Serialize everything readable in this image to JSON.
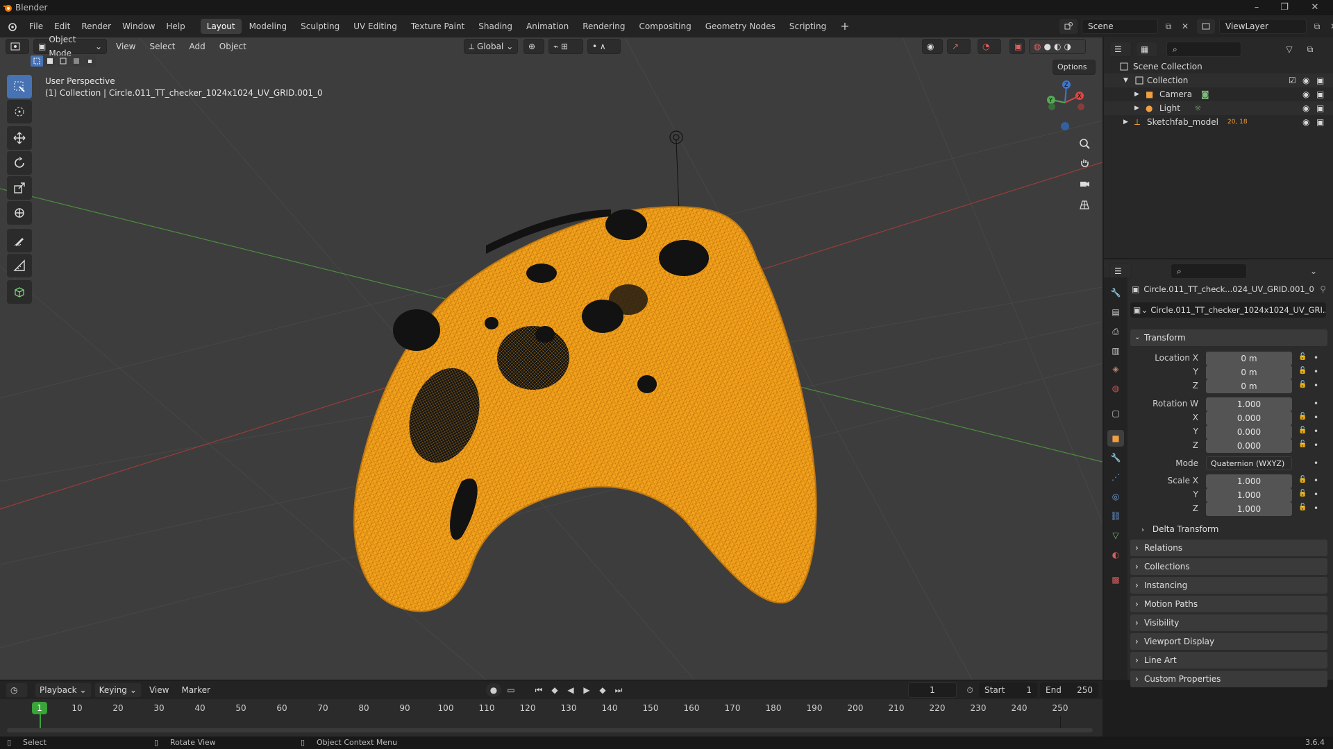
{
  "window": {
    "title": "Blender"
  },
  "menu": [
    "File",
    "Edit",
    "Render",
    "Window",
    "Help"
  ],
  "workspaces": [
    "Layout",
    "Modeling",
    "Sculpting",
    "UV Editing",
    "Texture Paint",
    "Shading",
    "Animation",
    "Rendering",
    "Compositing",
    "Geometry Nodes",
    "Scripting"
  ],
  "active_workspace": "Layout",
  "scene": {
    "name": "Scene",
    "view_layer": "ViewLayer"
  },
  "viewport": {
    "mode": "Object Mode",
    "menus": [
      "View",
      "Select",
      "Add",
      "Object"
    ],
    "orientation": "Global",
    "options_label": "Options",
    "perspective_label": "User Perspective",
    "object_info": "(1) Collection | Circle.011_TT_checker_1024x1024_UV_GRID.001_0",
    "wire_color": "#f0a020"
  },
  "outliner": {
    "root": "Scene Collection",
    "items": [
      {
        "name": "Collection",
        "level": 0
      },
      {
        "name": "Camera",
        "level": 1
      },
      {
        "name": "Light",
        "level": 1
      },
      {
        "name": "Sketchfab_model",
        "level": 0,
        "badge": "20, 18"
      }
    ]
  },
  "properties": {
    "object_name_short": "Circle.011_TT_check...024_UV_GRID.001_0",
    "object_name_field": "Circle.011_TT_checker_1024x1024_UV_GRI...",
    "transform_label": "Transform",
    "location_label": "Location X",
    "location": [
      "0 m",
      "0 m",
      "0 m"
    ],
    "rotation_label": "Rotation W",
    "rotation": [
      "1.000",
      "0.000",
      "0.000",
      "0.000"
    ],
    "mode_label": "Mode",
    "mode_value": "Quaternion (WXYZ)",
    "scale_label": "Scale X",
    "scale": [
      "1.000",
      "1.000",
      "1.000"
    ],
    "axis_labels": [
      "X",
      "Y",
      "Z"
    ],
    "delta_label": "Delta Transform",
    "panels": [
      "Relations",
      "Collections",
      "Instancing",
      "Motion Paths",
      "Visibility",
      "Viewport Display",
      "Line Art",
      "Custom Properties"
    ]
  },
  "timeline": {
    "menus": [
      "Playback",
      "Keying",
      "View",
      "Marker"
    ],
    "current_frame": "1",
    "start_label": "Start",
    "start": "1",
    "end_label": "End",
    "end": "250",
    "ticks": [
      "10",
      "20",
      "30",
      "40",
      "50",
      "60",
      "70",
      "80",
      "90",
      "100",
      "110",
      "120",
      "130",
      "140",
      "150",
      "160",
      "170",
      "180",
      "190",
      "200",
      "210",
      "220",
      "230",
      "240",
      "250"
    ]
  },
  "status": {
    "select": "Select",
    "rotate": "Rotate View",
    "context": "Object Context Menu",
    "version": "3.6.4"
  },
  "colors": {
    "accent": "#4772b3",
    "frame_green": "#3aa33a"
  }
}
